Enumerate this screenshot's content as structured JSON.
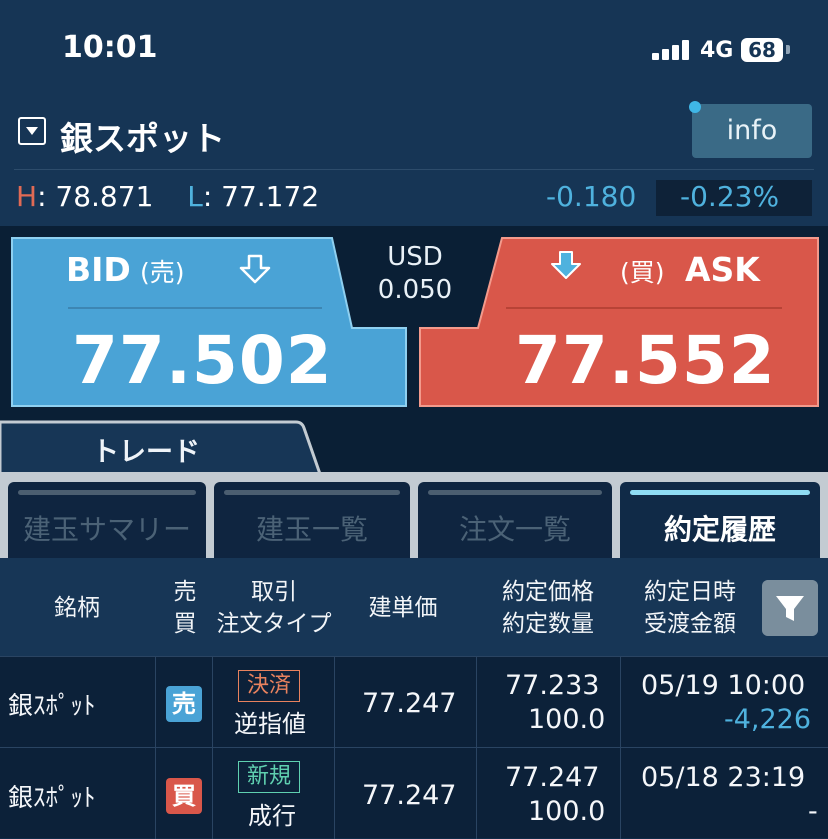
{
  "status_bar": {
    "time": "10:01",
    "network": "4G",
    "battery": "68"
  },
  "header": {
    "symbol": "銀スポット",
    "info_label": "info",
    "high_label": "H",
    "high_value": "78.871",
    "low_label": "L",
    "low_value": "77.172",
    "change": "-0.180",
    "change_pct": "-0.23%"
  },
  "quote": {
    "bid_label": "BID",
    "bid_sub": "(売)",
    "bid_price": "77.502",
    "ask_label": "ASK",
    "ask_sub": "(買)",
    "ask_price": "77.552",
    "spread_currency": "USD",
    "spread_value": "0.050"
  },
  "tabs": {
    "main": "トレード"
  },
  "subtabs": [
    {
      "label": "建玉サマリー",
      "active": false
    },
    {
      "label": "建玉一覧",
      "active": false
    },
    {
      "label": "注文一覧",
      "active": false
    },
    {
      "label": "約定履歴",
      "active": true
    }
  ],
  "table": {
    "headers": {
      "symbol": "銘柄",
      "side_1": "売",
      "side_2": "買",
      "type_1": "取引",
      "type_2": "注文タイプ",
      "open_price": "建単価",
      "exec_1": "約定価格",
      "exec_2": "約定数量",
      "date_1": "約定日時",
      "date_2": "受渡金額"
    },
    "rows": [
      {
        "symbol": "銀ｽﾎﾟｯﾄ",
        "side": "売",
        "trade_type": "決済",
        "order_type": "逆指値",
        "open_price": "77.247",
        "exec_price": "77.233",
        "quantity": "100.0",
        "date": "05/19 10:00",
        "amount": "-4,226"
      },
      {
        "symbol": "銀ｽﾎﾟｯﾄ",
        "side": "買",
        "trade_type": "新規",
        "order_type": "成行",
        "open_price": "77.247",
        "exec_price": "77.247",
        "quantity": "100.0",
        "date": "05/18 23:19",
        "amount": "-"
      }
    ]
  },
  "colors": {
    "bid": "#4aa3d6",
    "ask": "#d9574a",
    "positive_blue": "#4fb2de",
    "close_tag": "#e8825e",
    "new_tag": "#5fd0b0"
  },
  "icons": [
    "dropdown-icon",
    "bid-arrow-icon",
    "ask-arrow-icon",
    "filter-icon",
    "signal-icon",
    "battery-icon"
  ]
}
